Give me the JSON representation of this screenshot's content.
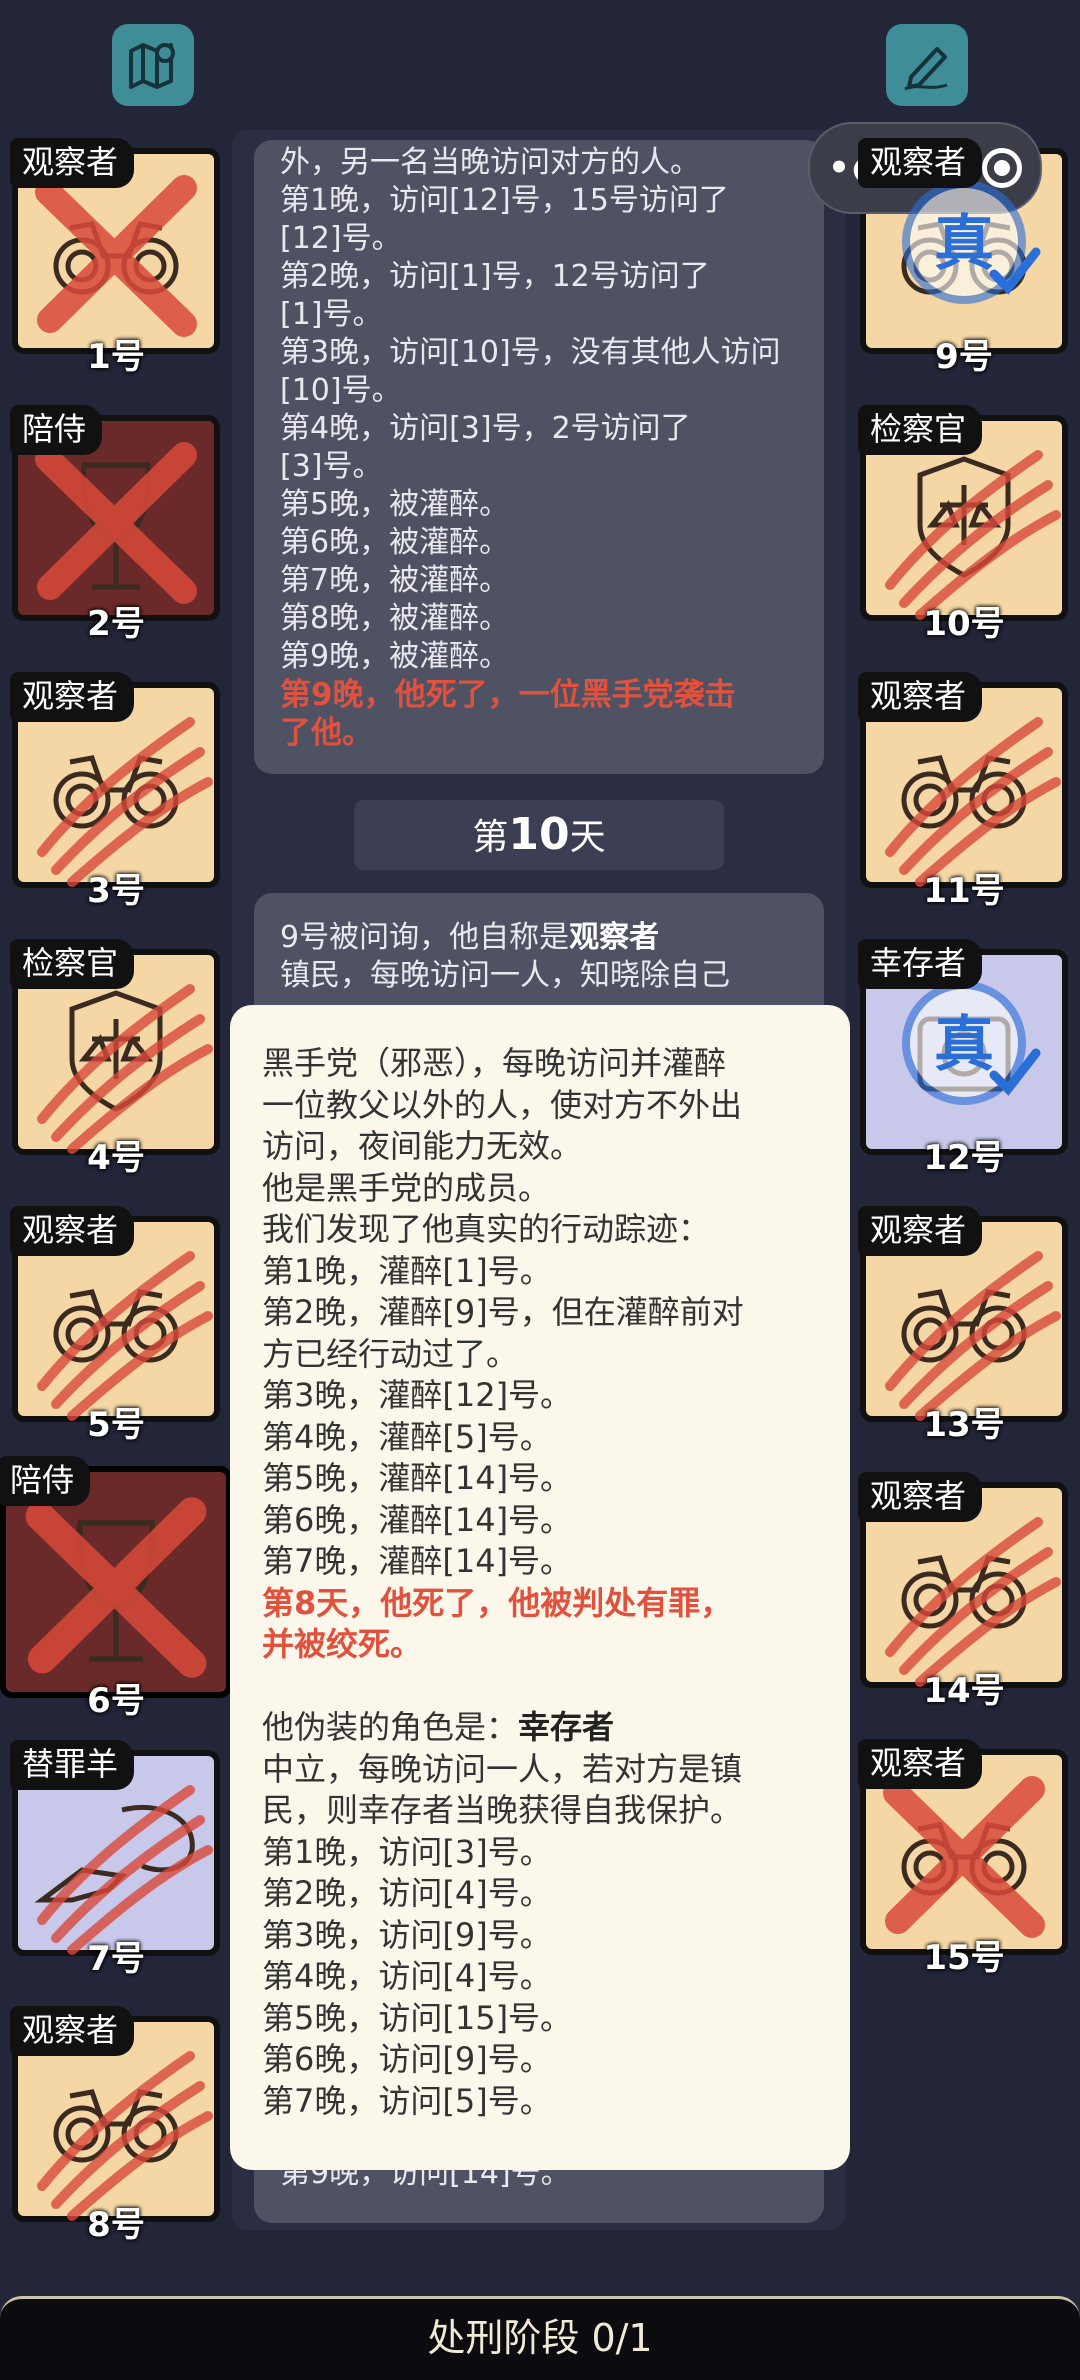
{
  "top_icons": {
    "left": "map-pin-icon",
    "right": "pen-edit-icon"
  },
  "capsule": {
    "menu": "•●•"
  },
  "cards": [
    {
      "role": "观察者",
      "num": "1号"
    },
    {
      "role": "陪侍",
      "num": "2号"
    },
    {
      "role": "观察者",
      "num": "3号"
    },
    {
      "role": "检察官",
      "num": "4号"
    },
    {
      "role": "观察者",
      "num": "5号"
    },
    {
      "role": "陪侍",
      "num": "6号"
    },
    {
      "role": "替罪羊",
      "num": "7号"
    },
    {
      "role": "观察者",
      "num": "8号"
    },
    {
      "role": "观察者",
      "num": "9号"
    },
    {
      "role": "检察官",
      "num": "10号"
    },
    {
      "role": "观察者",
      "num": "11号"
    },
    {
      "role": "幸存者",
      "num": "12号"
    },
    {
      "role": "观察者",
      "num": "13号"
    },
    {
      "role": "观察者",
      "num": "14号"
    },
    {
      "role": "观察者",
      "num": "15号"
    }
  ],
  "log1": [
    "外，另一名当晚访问对方的人。",
    "第1晚，访问[12]号，15号访问了",
    "[12]号。",
    "第2晚，访问[1]号，12号访问了",
    "[1]号。",
    "第3晚，访问[10]号，没有其他人访问",
    "[10]号。",
    "第4晚，访问[3]号，2号访问了",
    "[3]号。",
    "第5晚，被灌醉。",
    "第6晚，被灌醉。",
    "第7晚，被灌醉。",
    "第8晚，被灌醉。",
    "第9晚，被灌醉。"
  ],
  "log1_death": [
    "第9晚，他死了，一位黑手党袭击",
    "了他。"
  ],
  "day_label": {
    "prefix": "第",
    "num": "10",
    "suffix": "天"
  },
  "log2": {
    "intro": "9号被问询，他自称是",
    "claim": "观察者",
    "line2": "镇民，每晚访问一人，知晓除自己",
    "last": "第9晚，访问[14]号。"
  },
  "popup": {
    "lines1": [
      "黑手党（邪恶），每晚访问并灌醉",
      "一位教父以外的人，使对方不外出",
      "访问，夜间能力无效。",
      "他是黑手党的成员。",
      "我们发现了他真实的行动踪迹：",
      "第1晚，灌醉[1]号。",
      "第2晚，灌醉[9]号，但在灌醉前对",
      "方已经行动过了。",
      "第3晚，灌醉[12]号。",
      "第4晚，灌醉[5]号。",
      "第5晚，灌醉[14]号。",
      "第6晚，灌醉[14]号。",
      "第7晚，灌醉[14]号。"
    ],
    "death": [
      "第8天，他死了，他被判处有罪，",
      "并被绞死。"
    ],
    "disguise_prefix": "他伪装的角色是：",
    "disguise_role": "幸存者",
    "lines2": [
      "中立，每晚访问一人，若对方是镇",
      "民，则幸存者当晚获得自我保护。",
      "第1晚，访问[3]号。",
      "第2晚，访问[4]号。",
      "第3晚，访问[9]号。",
      "第4晚，访问[4]号。",
      "第5晚，访问[15]号。",
      "第6晚，访问[9]号。",
      "第7晚，访问[5]号。"
    ]
  },
  "bottom": {
    "label": "处刑阶段 0/1"
  },
  "colors": {
    "accent_red": "#e0513e",
    "card_bg": "#f4d7a5",
    "popup_bg": "#fbf7ea",
    "bg": "#232538"
  }
}
